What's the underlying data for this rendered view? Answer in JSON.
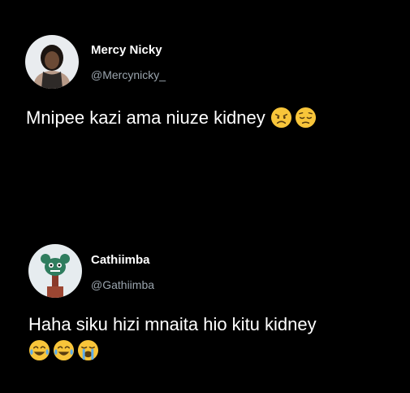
{
  "tweets": [
    {
      "display_name": "Mercy Nicky",
      "handle": "@Mercynicky_",
      "text": "Mnipee kazi ama niuze kidney",
      "emojis": [
        "disappointed-face-icon",
        "pensive-face-icon"
      ]
    },
    {
      "display_name": "Cathiimba",
      "handle": "@Gathiimba",
      "text": "Haha siku hizi mnaita hio kitu kidney",
      "emojis": [
        "tears-of-joy-icon",
        "tears-of-joy-icon",
        "loudly-crying-face-icon"
      ]
    }
  ],
  "colors": {
    "background": "#000000",
    "name": "#ffffff",
    "handle": "#9aa4ad",
    "text": "#ffffff",
    "emoji_yellow": "#f8c53a",
    "tear_blue": "#5dadec"
  }
}
